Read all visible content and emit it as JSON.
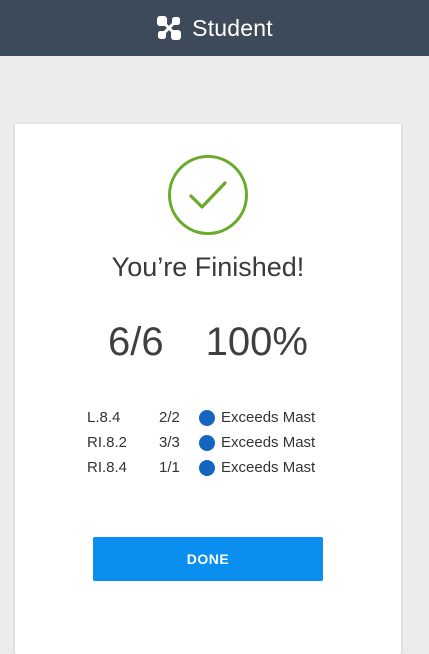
{
  "header": {
    "app_name": "Student",
    "icon": "nodes-icon"
  },
  "result": {
    "title": "You’re Finished!",
    "score": "6/6",
    "percent": "100%",
    "check_icon": "checkmark-circle-icon",
    "check_color": "#6aab2b"
  },
  "standards": [
    {
      "code": "L.8.4",
      "score": "2/2",
      "level": "Exceeds Mast"
    },
    {
      "code": "RI.8.2",
      "score": "3/3",
      "level": "Exceeds Mast"
    },
    {
      "code": "RI.8.4",
      "score": "1/1",
      "level": "Exceeds Mast"
    }
  ],
  "colors": {
    "topbar": "#3d4a5a",
    "level_dot": "#1565c0",
    "button": "#0a8ef0"
  },
  "done_label": "DONE"
}
